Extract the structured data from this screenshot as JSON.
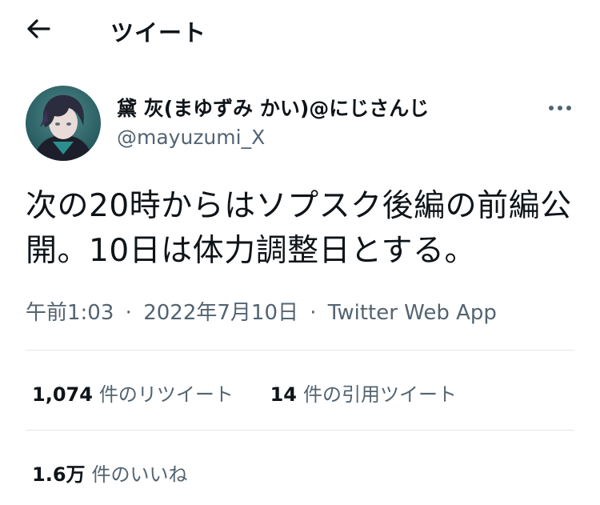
{
  "header": {
    "title": "ツイート",
    "back_icon": "arrow-left-icon"
  },
  "author": {
    "display_name": "黛 灰(まゆずみ かい)@にじさんじ",
    "handle": "@mayuzumi_X",
    "more_icon": "more-horizontal-icon"
  },
  "tweet": {
    "text": "次の20時からはソプスク後編の前編公開。10日は体力調整日とする。",
    "time": "午前1:03",
    "separator": "·",
    "date": "2022年7月10日",
    "source": "Twitter Web App"
  },
  "stats": {
    "retweets": {
      "count": "1,074",
      "label": "件のリツイート"
    },
    "quotes": {
      "count": "14",
      "label": "件の引用ツイート"
    },
    "likes": {
      "count": "1.6万",
      "label": "件のいいね"
    }
  },
  "colors": {
    "text": "#0f1419",
    "secondary": "#536471",
    "divider": "#e4e6e8"
  }
}
